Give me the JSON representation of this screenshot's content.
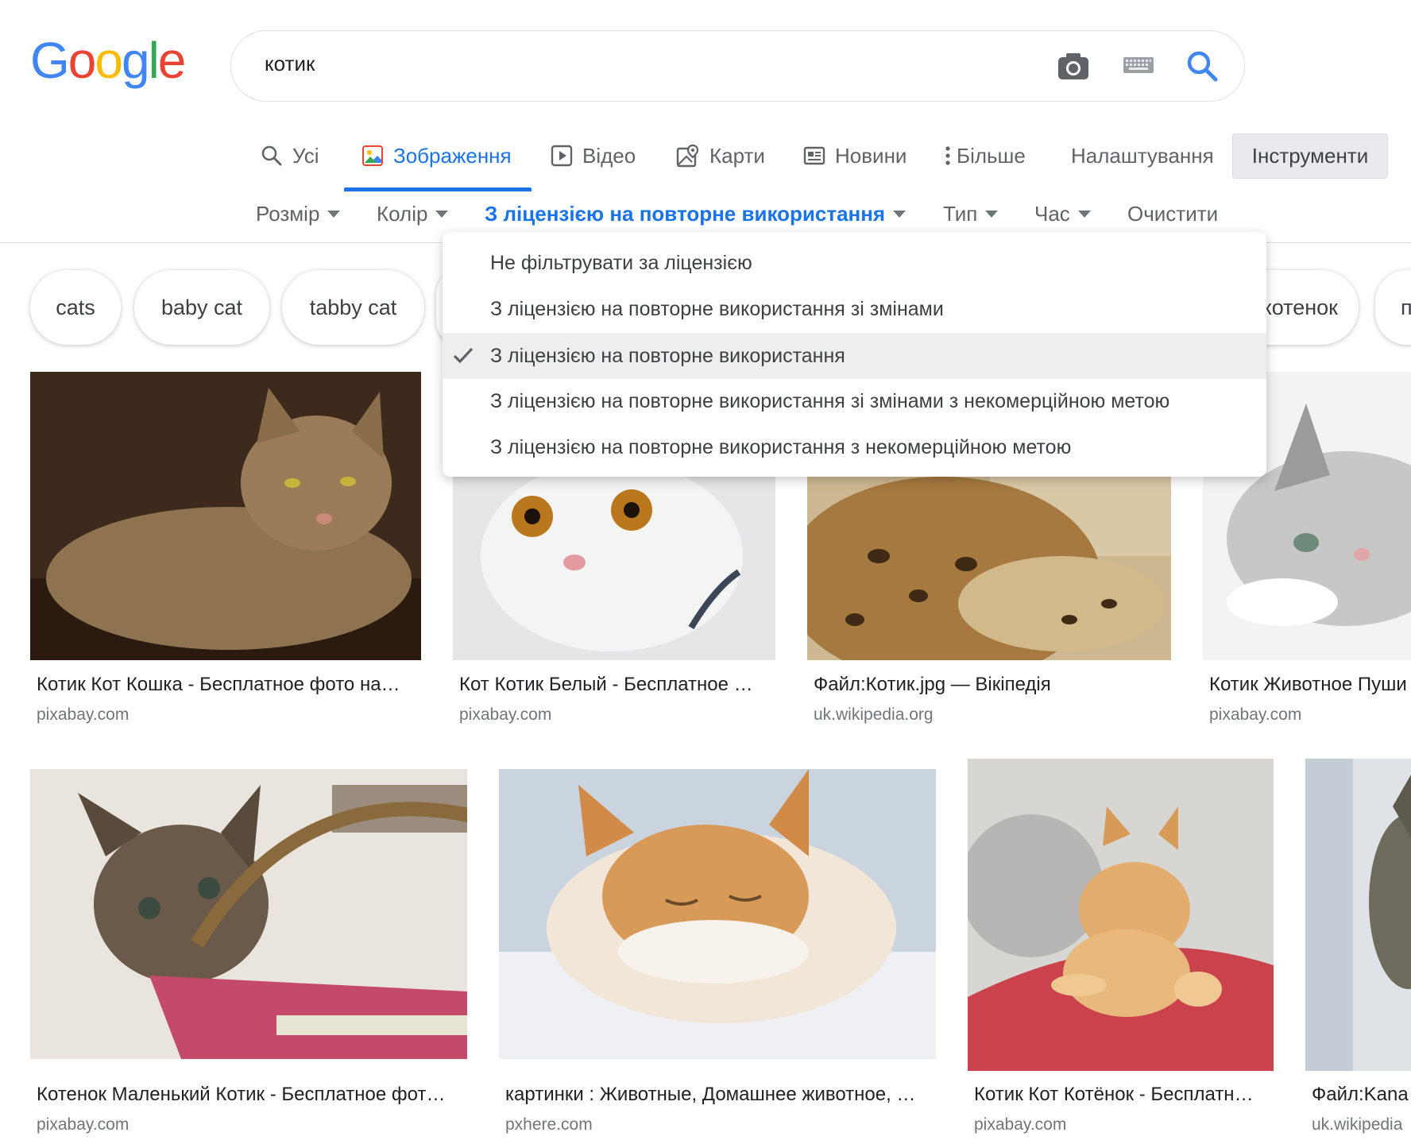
{
  "colors": {
    "accent": "#1a73e8",
    "text": "#202124",
    "muted": "#70757a",
    "g_blue": "#4285f4",
    "g_red": "#ea4335",
    "g_yellow": "#fbbc05",
    "g_green": "#34a853"
  },
  "logo": {
    "letters": [
      "G",
      "o",
      "o",
      "g",
      "l",
      "e"
    ]
  },
  "search": {
    "query": "котик"
  },
  "tabs": [
    {
      "label": "Усі",
      "icon": "search-icon"
    },
    {
      "label": "Зображення",
      "icon": "image-icon",
      "active": true
    },
    {
      "label": "Відео",
      "icon": "video-icon"
    },
    {
      "label": "Карти",
      "icon": "map-icon"
    },
    {
      "label": "Новини",
      "icon": "news-icon"
    },
    {
      "label": "Більше",
      "icon": "more-vert-icon"
    }
  ],
  "settings_label": "Налаштування",
  "tools_label": "Інструменти",
  "filters": [
    {
      "label": "Розмір"
    },
    {
      "label": "Колір"
    },
    {
      "label": "З ліцензією на повторне використання",
      "active": true
    },
    {
      "label": "Тип"
    },
    {
      "label": "Час"
    }
  ],
  "clear_label": "Очистити",
  "chips": [
    "cats",
    "baby cat",
    "tabby cat",
    "котенок",
    "п"
  ],
  "license_menu": {
    "items": [
      "Не фільтрувати за ліцензією",
      "З ліцензією на повторне використання зі змінами",
      "З ліцензією на повторне використання",
      "З ліцензією на повторне використання зі змінами з некомерційною метою",
      "З ліцензією на повторне використання з некомерційною метою"
    ],
    "selected_index": 2
  },
  "results": [
    {
      "caption": "Котик Кот Кошка - Бесплатное фото на…",
      "source": "pixabay.com"
    },
    {
      "caption": "Кот Котик Белый - Бесплатное …",
      "source": "pixabay.com"
    },
    {
      "caption": "Файл:Котик.jpg — Вікіпедія",
      "source": "uk.wikipedia.org"
    },
    {
      "caption": "Котик Животное Пуши",
      "source": "pixabay.com"
    },
    {
      "caption": "Котенок Маленький Котик - Бесплатное фот…",
      "source": "pixabay.com"
    },
    {
      "caption": "картинки : Животные, Домашнее животное, …",
      "source": "pxhere.com"
    },
    {
      "caption": "Котик Кот Котёнок - Бесплатн…",
      "source": "pixabay.com"
    },
    {
      "caption": "Файл:Kana",
      "source": "uk.wikipedia"
    }
  ]
}
